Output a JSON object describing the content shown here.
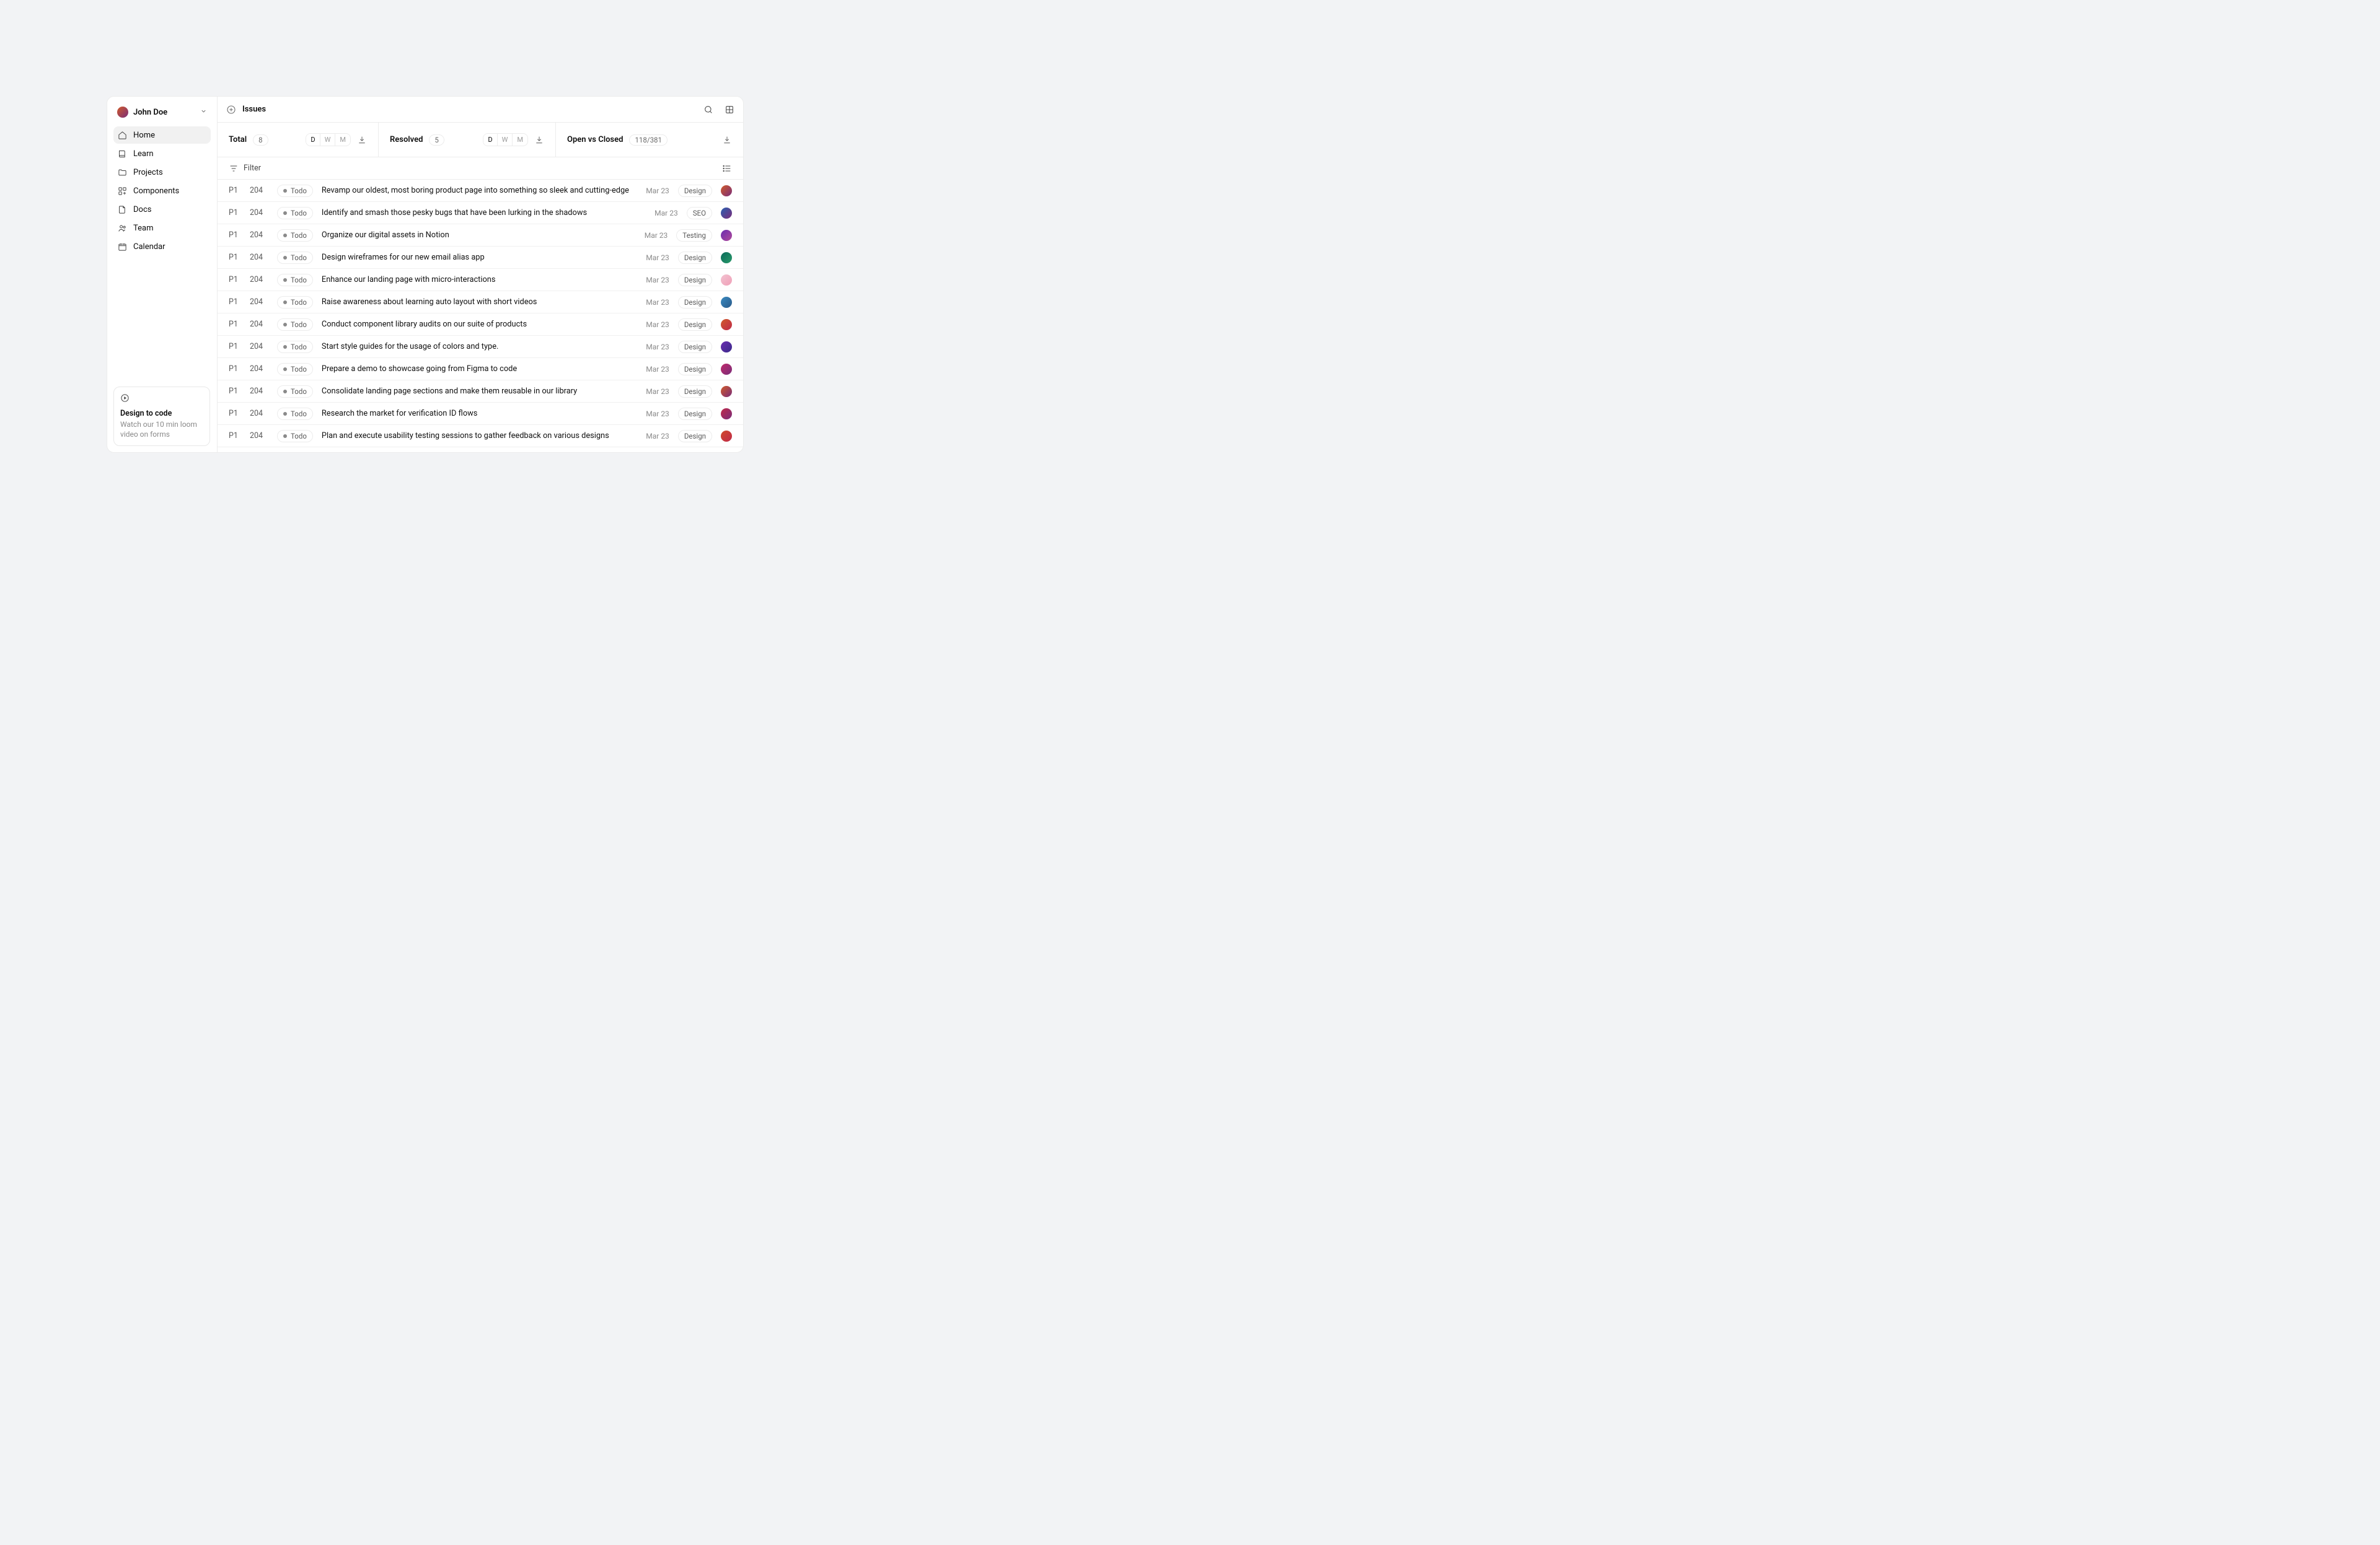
{
  "sidebar": {
    "user": {
      "name": "John Doe"
    },
    "nav": [
      {
        "label": "Home",
        "icon": "home-icon",
        "active": true
      },
      {
        "label": "Learn",
        "icon": "book-icon",
        "active": false
      },
      {
        "label": "Projects",
        "icon": "folder-icon",
        "active": false
      },
      {
        "label": "Components",
        "icon": "grid-add-icon",
        "active": false
      },
      {
        "label": "Docs",
        "icon": "file-icon",
        "active": false
      },
      {
        "label": "Team",
        "icon": "people-icon",
        "active": false
      },
      {
        "label": "Calendar",
        "icon": "calendar-icon",
        "active": false
      }
    ],
    "promo": {
      "title": "Design to code",
      "subtitle": "Watch our 10 min loom video on forms"
    }
  },
  "header": {
    "title": "Issues"
  },
  "stats": {
    "total": {
      "label": "Total",
      "count": "8"
    },
    "resolved": {
      "label": "Resolved",
      "count": "5"
    },
    "open": {
      "label": "Open vs Closed",
      "count": "118/381"
    },
    "segments": [
      "D",
      "W",
      "M"
    ]
  },
  "filter": {
    "label": "Filter"
  },
  "issues": [
    {
      "priority": "P1",
      "id": "204",
      "status": "Todo",
      "title": "Revamp our oldest, most boring product page into something so sleek and cutting-edge",
      "date": "Mar 23",
      "tag": "Design",
      "avatar": 0
    },
    {
      "priority": "P1",
      "id": "204",
      "status": "Todo",
      "title": "Identify and smash those pesky bugs that have been lurking in the shadows",
      "date": "Mar 23",
      "tag": "SEO",
      "avatar": 1
    },
    {
      "priority": "P1",
      "id": "204",
      "status": "Todo",
      "title": "Organize our digital assets in Notion",
      "date": "Mar 23",
      "tag": "Testing",
      "avatar": 2
    },
    {
      "priority": "P1",
      "id": "204",
      "status": "Todo",
      "title": "Design wireframes for our new email alias app",
      "date": "Mar 23",
      "tag": "Design",
      "avatar": 3
    },
    {
      "priority": "P1",
      "id": "204",
      "status": "Todo",
      "title": "Enhance our landing page with micro-interactions",
      "date": "Mar 23",
      "tag": "Design",
      "avatar": 4
    },
    {
      "priority": "P1",
      "id": "204",
      "status": "Todo",
      "title": "Raise awareness about learning auto layout with short videos",
      "date": "Mar 23",
      "tag": "Design",
      "avatar": 5
    },
    {
      "priority": "P1",
      "id": "204",
      "status": "Todo",
      "title": "Conduct component library audits on our suite of products",
      "date": "Mar 23",
      "tag": "Design",
      "avatar": 6
    },
    {
      "priority": "P1",
      "id": "204",
      "status": "Todo",
      "title": "Start style guides for the usage of colors and type.",
      "date": "Mar 23",
      "tag": "Design",
      "avatar": 7
    },
    {
      "priority": "P1",
      "id": "204",
      "status": "Todo",
      "title": "Prepare a demo to showcase going from Figma to code",
      "date": "Mar 23",
      "tag": "Design",
      "avatar": 8
    },
    {
      "priority": "P1",
      "id": "204",
      "status": "Todo",
      "title": "Consolidate landing page sections and make them reusable in our library",
      "date": "Mar 23",
      "tag": "Design",
      "avatar": 9
    },
    {
      "priority": "P1",
      "id": "204",
      "status": "Todo",
      "title": "Research the market for verification ID flows",
      "date": "Mar 23",
      "tag": "Design",
      "avatar": 10
    },
    {
      "priority": "P1",
      "id": "204",
      "status": "Todo",
      "title": "Plan and execute usability testing sessions to gather feedback on various designs",
      "date": "Mar 23",
      "tag": "Design",
      "avatar": 11
    }
  ]
}
